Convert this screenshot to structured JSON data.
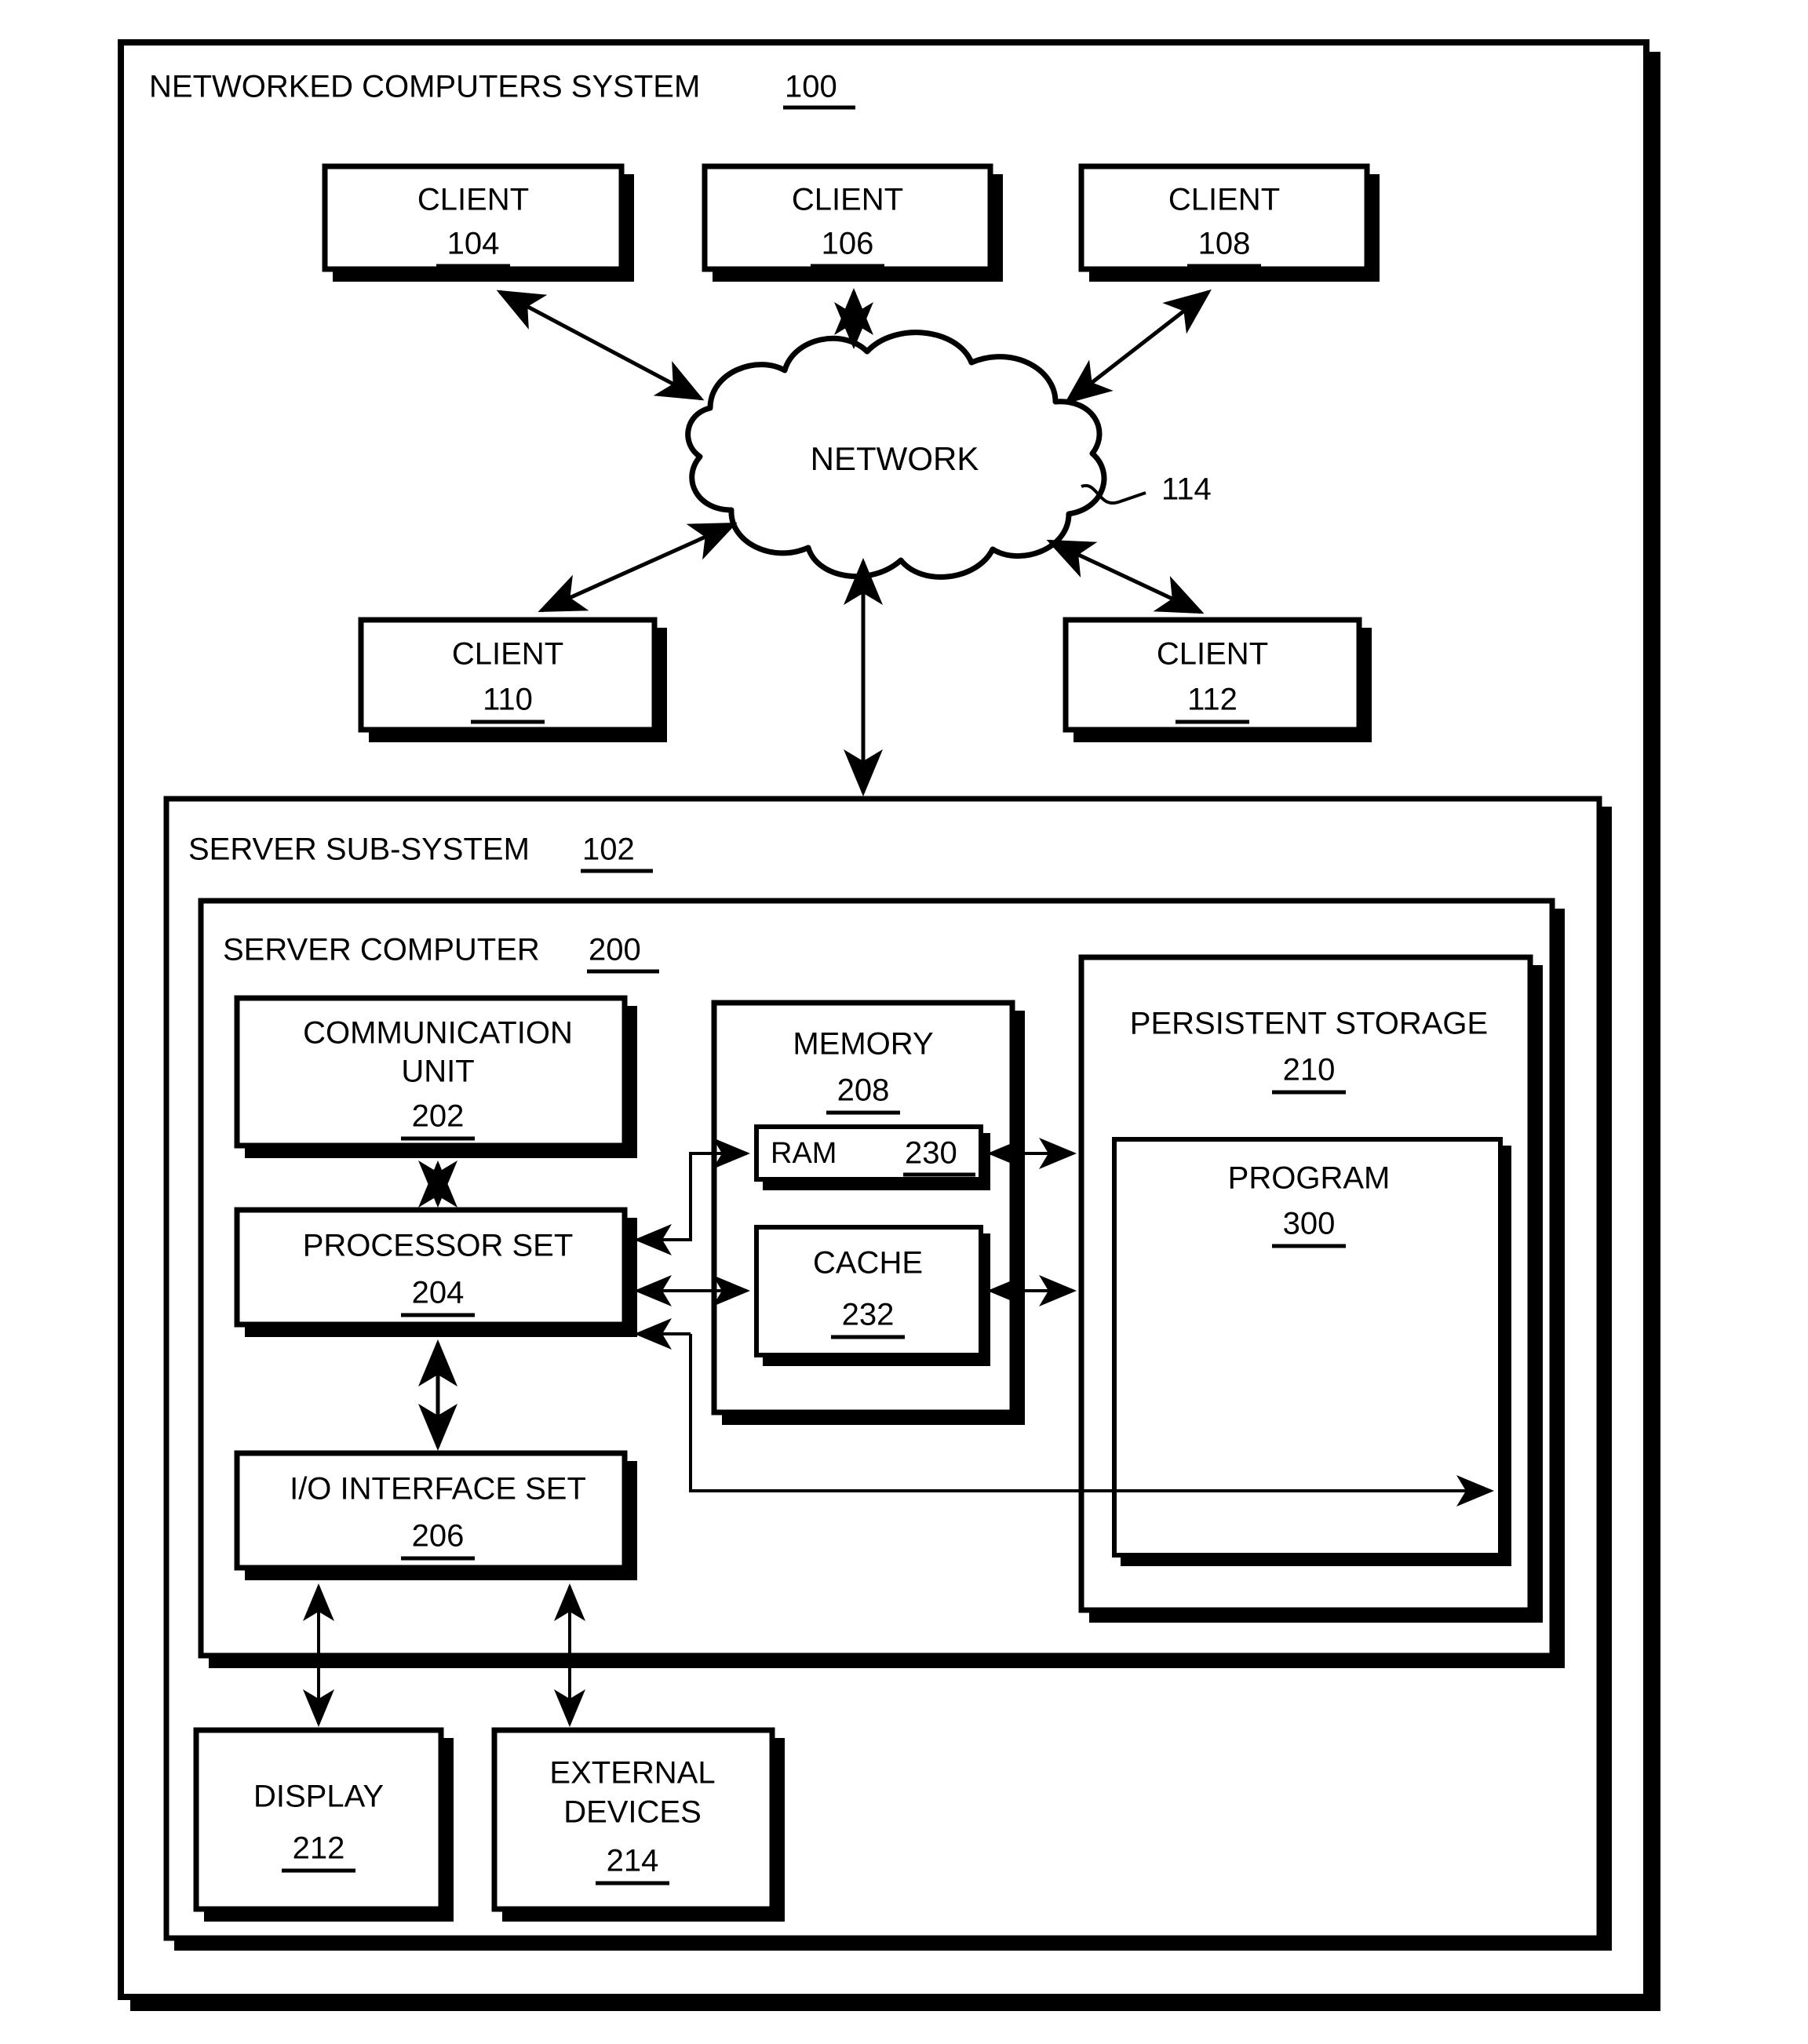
{
  "figure": {
    "outer_title": "NETWORKED COMPUTERS SYSTEM",
    "outer_ref": "100",
    "network_label": "NETWORK",
    "network_ref": "114",
    "subsystem_title": "SERVER SUB-SYSTEM",
    "subsystem_ref": "102",
    "computer_title": "SERVER COMPUTER",
    "computer_ref": "200"
  },
  "clients": [
    {
      "label": "CLIENT",
      "ref": "104"
    },
    {
      "label": "CLIENT",
      "ref": "106"
    },
    {
      "label": "CLIENT",
      "ref": "108"
    },
    {
      "label": "CLIENT",
      "ref": "110"
    },
    {
      "label": "CLIENT",
      "ref": "112"
    }
  ],
  "components": {
    "communication_unit": {
      "line1": "COMMUNICATION",
      "line2": "UNIT",
      "ref": "202"
    },
    "processor_set": {
      "label": "PROCESSOR SET",
      "ref": "204"
    },
    "io_interface_set": {
      "label": "I/O INTERFACE SET",
      "ref": "206"
    },
    "memory": {
      "label": "MEMORY",
      "ref": "208"
    },
    "ram": {
      "label": "RAM",
      "ref": "230"
    },
    "cache": {
      "label": "CACHE",
      "ref": "232"
    },
    "persistent_storage": {
      "label": "PERSISTENT STORAGE",
      "ref": "210"
    },
    "program": {
      "label": "PROGRAM",
      "ref": "300"
    },
    "display": {
      "label": "DISPLAY",
      "ref": "212"
    },
    "external_devices": {
      "line1": "EXTERNAL",
      "line2": "DEVICES",
      "ref": "214"
    }
  },
  "colors": {
    "line": "#000000",
    "background": "#ffffff"
  }
}
